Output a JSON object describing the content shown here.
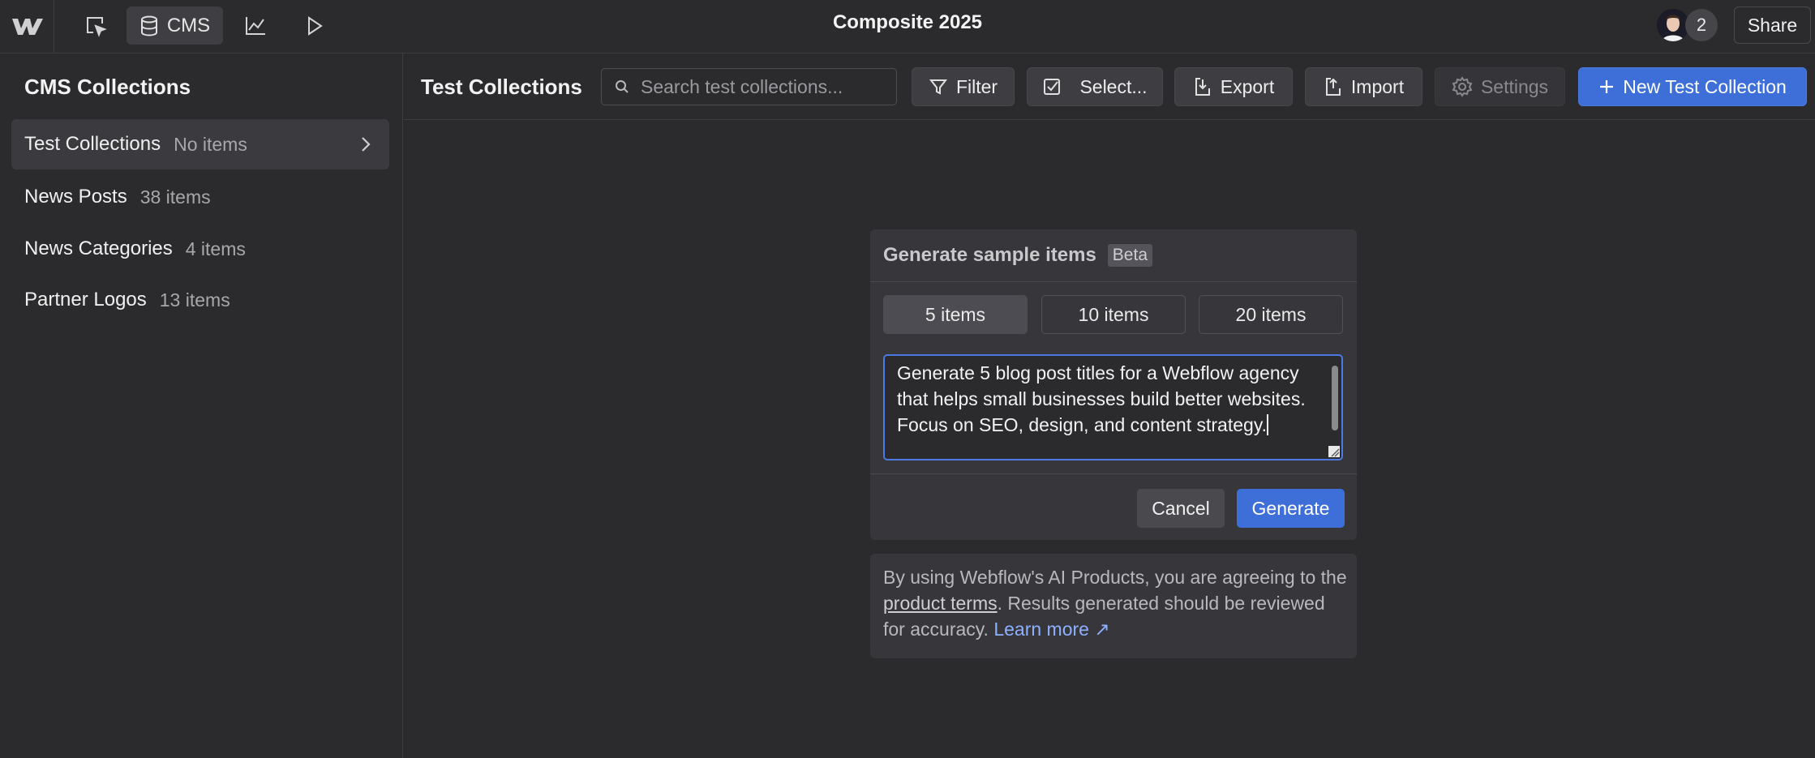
{
  "topbar": {
    "cms_label": "CMS",
    "title": "Composite 2025",
    "collaborator_count": "2",
    "share_label": "Share"
  },
  "sidebar": {
    "title": "CMS Collections",
    "items": [
      {
        "name": "Test Collections",
        "count": "No items",
        "active": true
      },
      {
        "name": "News Posts",
        "count": "38 items"
      },
      {
        "name": "News Categories",
        "count": "4 items"
      },
      {
        "name": "Partner Logos",
        "count": "13 items"
      }
    ]
  },
  "toolbar": {
    "title": "Test Collections",
    "search_placeholder": "Search test collections...",
    "filter_label": "Filter",
    "select_label": "Select...",
    "export_label": "Export",
    "import_label": "Import",
    "settings_label": "Settings",
    "new_label": "New Test Collection"
  },
  "modal": {
    "title": "Generate sample items",
    "badge": "Beta",
    "options": [
      "5 items",
      "10 items",
      "20 items"
    ],
    "selected_option": "5 items",
    "prompt": "Generate 5 blog post titles for a Webflow agency that helps small businesses build better websites. Focus on SEO, design, and content strategy.",
    "cancel_label": "Cancel",
    "generate_label": "Generate"
  },
  "notice": {
    "text_before": "By using Webflow's AI Products, you are agreeing to the ",
    "link": "product terms",
    "text_after": ". Results generated should be reviewed for accuracy. ",
    "learn_more": "Learn more ↗"
  },
  "colors": {
    "background": "#2b2a2d",
    "panel": "#37363b",
    "accent": "#3e6fd8",
    "link": "#8db1ff"
  }
}
